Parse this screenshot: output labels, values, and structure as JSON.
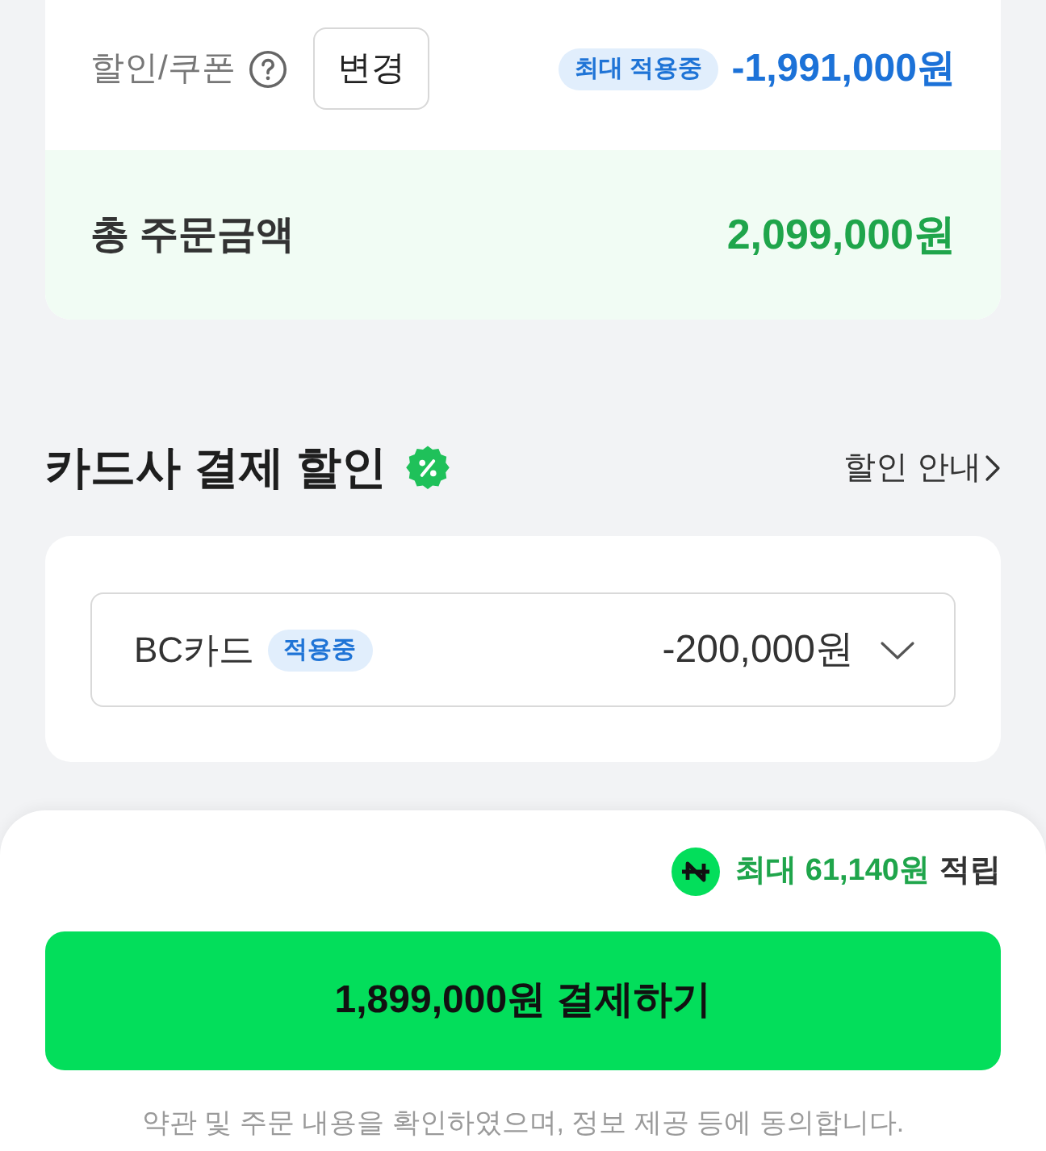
{
  "discount_row": {
    "label": "할인/쿠폰",
    "change_button": "변경",
    "badge": "최대 적용중",
    "amount": "-1,991,000원"
  },
  "total": {
    "label": "총 주문금액",
    "amount": "2,099,000원"
  },
  "card_discount": {
    "title": "카드사 결제 할인",
    "guide_link": "할인 안내",
    "card_select": {
      "card": "BC카드",
      "badge": "적용중",
      "amount": "-200,000원",
      "expanded": false
    }
  },
  "bottom_sheet": {
    "points_max": "최대 61,140원",
    "points_suffix": "적립",
    "pay_button": "1,899,000원 결제하기",
    "agreement": "약관 및 주문 내용을 확인하였으며, 정보 제공 등에 동의합니다."
  }
}
